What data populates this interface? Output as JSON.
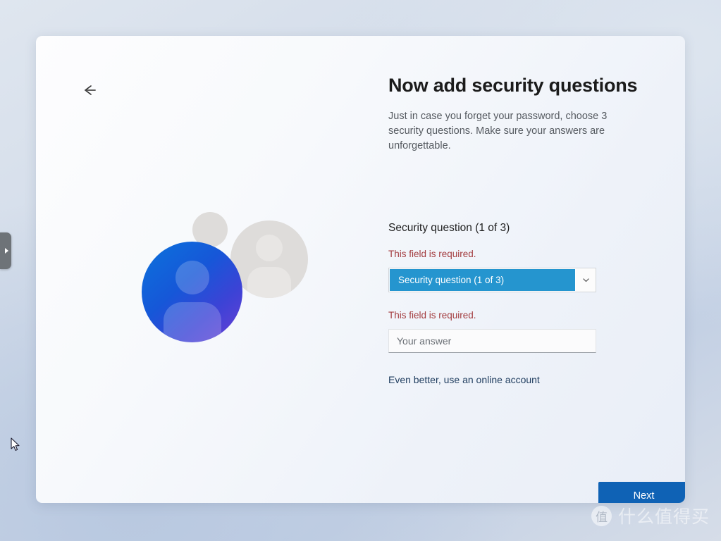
{
  "window": {
    "back_button_icon": "arrow-left-icon"
  },
  "edge_tab": {
    "icon": "triangle-right-icon"
  },
  "illustration": {
    "icon": "user-avatar-illustration",
    "blue_gradient_start": "#0b73dc",
    "blue_gradient_end": "#6b3fd4",
    "grey_color": "#dedcda"
  },
  "header": {
    "title": "Now add security questions",
    "subtitle": "Just in case you forget your password, choose 3 security questions. Make sure your answers are unforgettable."
  },
  "form": {
    "field_label": "Security question (1 of 3)",
    "question_error": "This field is required.",
    "question_selected": "Security question (1 of 3)",
    "question_dropdown_icon": "chevron-down-icon",
    "question_highlight_color": "#2595cf",
    "answer_error": "This field is required.",
    "answer_value": "",
    "answer_placeholder": "Your answer",
    "online_account_link": "Even better, use an online account",
    "error_color": "#a33c3f",
    "link_color": "#1e3c5e"
  },
  "footer": {
    "next_label": "Next",
    "next_color": "#0f62b5"
  },
  "watermark": {
    "badge": "值",
    "text": "什么值得买"
  }
}
